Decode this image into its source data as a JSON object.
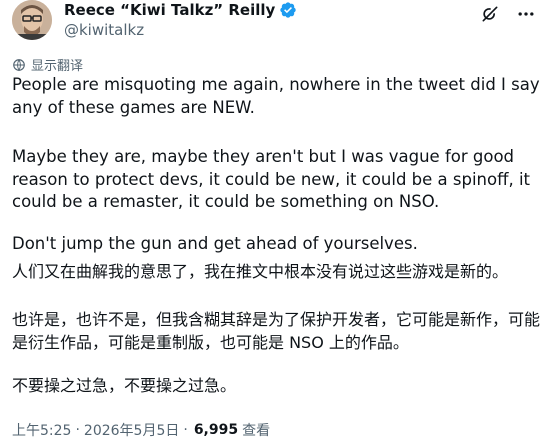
{
  "author": {
    "name": "Reece “Kiwi Talkz” Reilly",
    "handle": "@kiwitalkz",
    "verified": true
  },
  "header_icons": [
    "grok-icon",
    "more-icon"
  ],
  "translate_label": "显示翻译",
  "tweet_en": {
    "p1": "People are misquoting me again, nowhere in the tweet did I say any of these games are NEW.",
    "p2": "Maybe they are, maybe they aren't but I was vague for good reason to protect devs, it could be new, it could be a spinoff, it could be a remaster, it could be something on NSO.",
    "p3": "Don't jump the gun and get ahead of yourselves."
  },
  "tweet_zh": {
    "p1": "人们又在曲解我的意思了，我在推文中根本没有说过这些游戏是新的。",
    "p2": "也许是，也许不是，但我含糊其辞是为了保护开发者，它可能是新作，可能是衍生作品，可能是重制版，也可能是 NSO 上的作品。",
    "p3": "不要操之过急，不要操之过急。"
  },
  "meta": {
    "time": "上午5:25",
    "date": "2026年5月5日",
    "separator": "·",
    "views_count": "6,995",
    "views_label": "查看"
  },
  "colors": {
    "text": "#0f1419",
    "secondary": "#536471",
    "verified": "#1d9bf0"
  }
}
